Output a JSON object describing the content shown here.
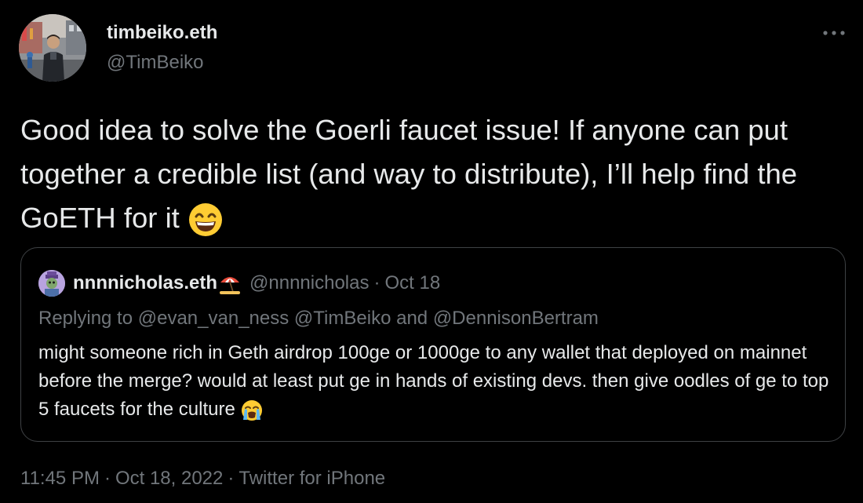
{
  "author": {
    "display_name": "timbeiko.eth",
    "handle": "@TimBeiko"
  },
  "tweet": {
    "text": "Good idea to solve the Goerli faucet issue! If anyone can put together a credible list (and way to distribute), I’ll help find the GoETH for it",
    "emoji": "grinning-face-with-smiling-eyes"
  },
  "quoted": {
    "display_name": "nnnnicholas.eth",
    "name_emoji": "beach-umbrella",
    "handle": "@nnnnicholas",
    "separator": "·",
    "date": "Oct 18",
    "replying_prefix": "Replying to",
    "mention_1": "@evan_van_ness",
    "mention_2": "@TimBeiko",
    "and_word": "and",
    "mention_3": "@DennisonBertram",
    "text": "might someone rich in Geth airdrop 100ge or 1000ge to any wallet that deployed on mainnet before the merge? would at least put ge in hands of existing devs. then give oodles of ge to top 5 faucets for the culture",
    "emoji": "loudly-crying-face"
  },
  "footer": {
    "time": "11:45 PM",
    "separator": "·",
    "date": "Oct 18, 2022",
    "source": "Twitter for iPhone"
  },
  "colors": {
    "background": "#000000",
    "primary_text": "#e7e9ea",
    "secondary_text": "#71767b",
    "border": "#3e4144"
  },
  "icons": {
    "more": "more-horizontal-icon"
  }
}
